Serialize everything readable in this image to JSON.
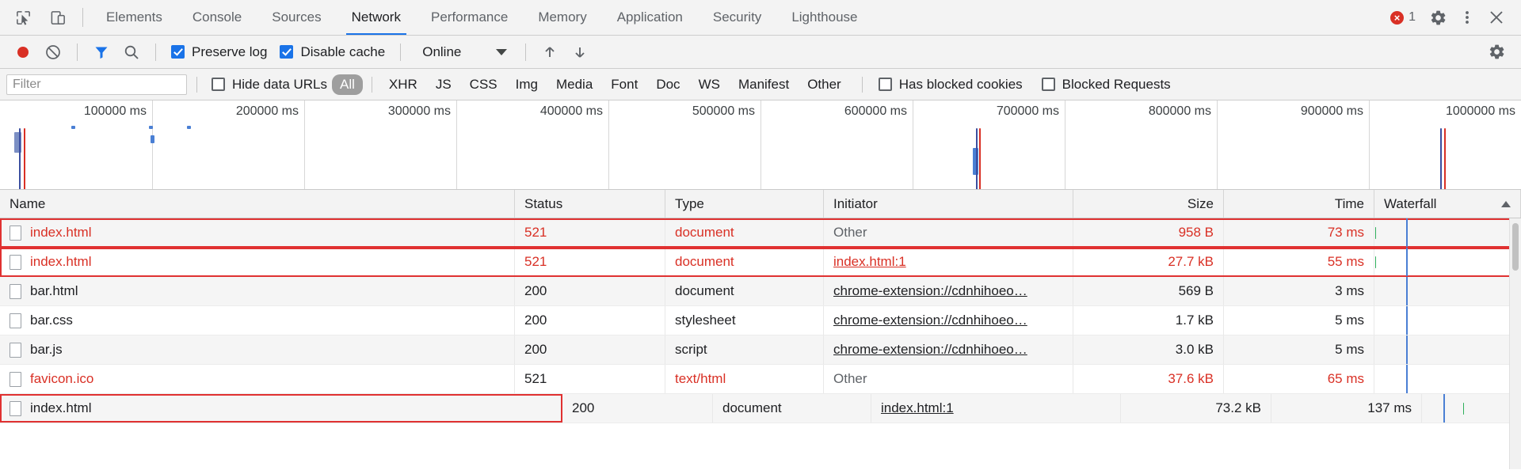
{
  "tabbar": {
    "inspect_icon": "inspect-cursor-icon",
    "device_icon": "device-toggle-icon",
    "tabs": [
      {
        "label": "Elements",
        "active": false
      },
      {
        "label": "Console",
        "active": false
      },
      {
        "label": "Sources",
        "active": false
      },
      {
        "label": "Network",
        "active": true
      },
      {
        "label": "Performance",
        "active": false
      },
      {
        "label": "Memory",
        "active": false
      },
      {
        "label": "Application",
        "active": false
      },
      {
        "label": "Security",
        "active": false
      },
      {
        "label": "Lighthouse",
        "active": false
      }
    ],
    "error_count": "1",
    "error_glyph": "×",
    "settings_icon": "gear-icon",
    "more_icon": "kebab-menu-icon",
    "close_icon": "close-icon"
  },
  "toolbar": {
    "record_icon": "record-button-icon",
    "clear_icon": "clear-network-log-icon",
    "filter_icon": "filter-funnel-icon",
    "search_icon": "search-icon",
    "preserve_log": {
      "label": "Preserve log",
      "checked": true
    },
    "disable_cache": {
      "label": "Disable cache",
      "checked": true
    },
    "throttle_value": "Online",
    "throttle_caret": "chevron-down-icon",
    "import_icon": "import-har-icon",
    "export_icon": "export-har-icon",
    "settings_icon": "network-settings-gear-icon"
  },
  "filterbar": {
    "filter_placeholder": "Filter",
    "filter_value": "",
    "hide_data_urls": {
      "label": "Hide data URLs",
      "checked": false
    },
    "types": [
      {
        "label": "All",
        "selected": true
      },
      {
        "label": "XHR",
        "selected": false
      },
      {
        "label": "JS",
        "selected": false
      },
      {
        "label": "CSS",
        "selected": false
      },
      {
        "label": "Img",
        "selected": false
      },
      {
        "label": "Media",
        "selected": false
      },
      {
        "label": "Font",
        "selected": false
      },
      {
        "label": "Doc",
        "selected": false
      },
      {
        "label": "WS",
        "selected": false
      },
      {
        "label": "Manifest",
        "selected": false
      },
      {
        "label": "Other",
        "selected": false
      }
    ],
    "has_blocked_cookies": {
      "label": "Has blocked cookies",
      "checked": false
    },
    "blocked_requests": {
      "label": "Blocked Requests",
      "checked": false
    }
  },
  "overview": {
    "tick_labels": [
      "100000 ms",
      "200000 ms",
      "300000 ms",
      "400000 ms",
      "500000 ms",
      "600000 ms",
      "700000 ms",
      "800000 ms",
      "900000 ms",
      "1000000 ms"
    ],
    "tick_interval_ms": 100000,
    "max_ms": 1000000
  },
  "table": {
    "columns": [
      {
        "label": "Name",
        "align": "left"
      },
      {
        "label": "Status",
        "align": "left"
      },
      {
        "label": "Type",
        "align": "left"
      },
      {
        "label": "Initiator",
        "align": "left"
      },
      {
        "label": "Size",
        "align": "right"
      },
      {
        "label": "Time",
        "align": "right"
      },
      {
        "label": "Waterfall",
        "align": "left"
      }
    ],
    "sort_icon": "sort-ascending-arrow-icon",
    "rows": [
      {
        "name": "index.html",
        "status": "521",
        "type": "document",
        "initiator": "Other",
        "initiator_style": "gray",
        "size": "958 B",
        "time": "73 ms",
        "error": true,
        "alt": true,
        "wf_left_pct": 0.6,
        "wf_width_pct": 0.5,
        "wf_color": "#2eaf5b"
      },
      {
        "name": "index.html",
        "status": "521",
        "type": "document",
        "initiator": "index.html:1",
        "initiator_style": "link-red",
        "size": "27.7 kB",
        "time": "55 ms",
        "error": true,
        "alt": false,
        "wf_left_pct": 0.6,
        "wf_width_pct": 0.5,
        "wf_color": "#2eaf5b"
      },
      {
        "name": "bar.html",
        "status": "200",
        "type": "document",
        "initiator": "chrome-extension://cdnhihoeo…",
        "initiator_style": "link",
        "size": "569 B",
        "time": "3 ms",
        "error": false,
        "alt": true,
        "wf_left_pct": 0,
        "wf_width_pct": 0,
        "wf_color": "#2eaf5b"
      },
      {
        "name": "bar.css",
        "status": "200",
        "type": "stylesheet",
        "initiator": "chrome-extension://cdnhihoeo…",
        "initiator_style": "link",
        "size": "1.7 kB",
        "time": "5 ms",
        "error": false,
        "alt": false,
        "wf_left_pct": 22,
        "wf_width_pct": 0.5,
        "wf_color": "#3b82d6"
      },
      {
        "name": "bar.js",
        "status": "200",
        "type": "script",
        "initiator": "chrome-extension://cdnhihoeo…",
        "initiator_style": "link",
        "size": "3.0 kB",
        "time": "5 ms",
        "error": false,
        "alt": true,
        "wf_left_pct": 22,
        "wf_width_pct": 0.5,
        "wf_color": "#3b82d6"
      },
      {
        "name": "favicon.ico",
        "status": "521",
        "type": "text/html",
        "initiator": "Other",
        "initiator_style": "gray",
        "size": "37.6 kB",
        "time": "65 ms",
        "error": false,
        "alt": false,
        "name_red": true,
        "wf_left_pct": 22,
        "wf_width_pct": 0.6,
        "wf_color": "#2eaf5b"
      },
      {
        "name": "index.html",
        "status": "200",
        "type": "document",
        "initiator": "index.html:1",
        "initiator_style": "link",
        "size": "73.2 kB",
        "time": "137 ms",
        "error": false,
        "alt": true,
        "name_boxed": true,
        "wf_left_pct": 42,
        "wf_width_pct": 1.1,
        "wf_color": "#2eaf5b"
      }
    ]
  }
}
